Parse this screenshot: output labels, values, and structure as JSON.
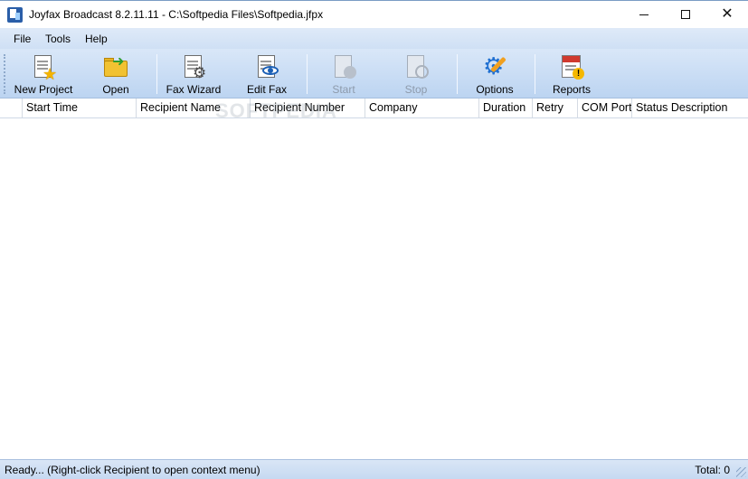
{
  "window": {
    "title": "Joyfax Broadcast 8.2.11.11 - C:\\Softpedia Files\\Softpedia.jfpx",
    "close_glyph": "✕"
  },
  "menu": [
    "File",
    "Tools",
    "Help"
  ],
  "toolbar": {
    "new_project": "New Project",
    "open": "Open",
    "fax_wizard": "Fax Wizard",
    "edit_fax": "Edit Fax",
    "start": "Start",
    "stop": "Stop",
    "options": "Options",
    "reports": "Reports"
  },
  "columns": [
    "Start Time",
    "Recipient Name",
    "Recipient Number",
    "Company",
    "Duration",
    "Retry",
    "COM Port",
    "Status Description"
  ],
  "watermark": "SOFTPEDIA",
  "status": {
    "left": "Ready... (Right-click Recipient to open context menu)",
    "right": "Total: 0"
  }
}
